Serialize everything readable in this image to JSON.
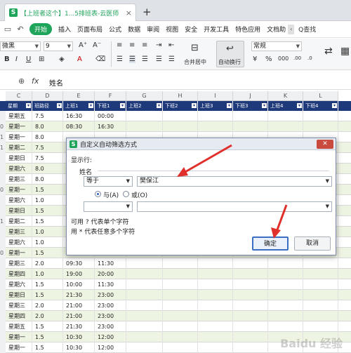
{
  "titlebar": {
    "tab_title": "【上班者这个】1...5排班表-云医师",
    "tab_icon_letter": "S",
    "close_glyph": "×",
    "new_tab_glyph": "+"
  },
  "menubar": {
    "start": "开始",
    "items": [
      "插入",
      "页面布局",
      "公式",
      "数据",
      "审阅",
      "视图",
      "安全",
      "开发工具",
      "特色应用",
      "文档助"
    ],
    "more_glyph": "‹",
    "search": "Q查找"
  },
  "ribbon": {
    "font_name": "微黑",
    "font_size": "9",
    "merge_center": "合并居中",
    "wrap_text": "自动换行",
    "number_format": "常规"
  },
  "formulabar": {
    "fx_label": "fx",
    "content": "姓名"
  },
  "columns": [
    "C",
    "D",
    "E",
    "F",
    "G",
    "H",
    "I",
    "J",
    "K",
    "L"
  ],
  "header_row": [
    "星期",
    "班路径",
    "上班1",
    "下班1",
    "上班2",
    "下班2",
    "上班3",
    "下班3",
    "上班4",
    "下班4"
  ],
  "rows": [
    {
      "rn": "",
      "day": "星期五",
      "hours": "7.5",
      "start": "16:30",
      "end": "00:00",
      "green": false
    },
    {
      "rn": "0",
      "day": "星期一",
      "hours": "8.0",
      "start": "08:30",
      "end": "16:30",
      "green": true
    },
    {
      "rn": "1",
      "day": "星期一",
      "hours": "8.0",
      "start": "",
      "end": "",
      "green": false
    },
    {
      "rn": "1",
      "day": "星期二",
      "hours": "7.5",
      "start": "",
      "end": "",
      "green": true
    },
    {
      "rn": "",
      "day": "星期日",
      "hours": "7.5",
      "start": "",
      "end": "",
      "green": false
    },
    {
      "rn": "",
      "day": "星期六",
      "hours": "8.0",
      "start": "",
      "end": "",
      "green": true
    },
    {
      "rn": "",
      "day": "星期三",
      "hours": "8.0",
      "start": "",
      "end": "",
      "green": false
    },
    {
      "rn": "0",
      "day": "星期一",
      "hours": "1.5",
      "start": "",
      "end": "",
      "green": true
    },
    {
      "rn": "",
      "day": "星期六",
      "hours": "1.0",
      "start": "",
      "end": "",
      "green": false
    },
    {
      "rn": "",
      "day": "星期日",
      "hours": "1.5",
      "start": "",
      "end": "",
      "green": true
    },
    {
      "rn": "1",
      "day": "星期二",
      "hours": "1.5",
      "start": "",
      "end": "",
      "green": false
    },
    {
      "rn": "",
      "day": "星期三",
      "hours": "1.0",
      "start": "",
      "end": "",
      "green": true
    },
    {
      "rn": "",
      "day": "星期六",
      "hours": "1.0",
      "start": "",
      "end": "",
      "green": false
    },
    {
      "rn": "0",
      "day": "星期一",
      "hours": "1.5",
      "start": "20:00",
      "end": "21:30",
      "green": true
    },
    {
      "rn": "",
      "day": "星期三",
      "hours": "2.0",
      "start": "09:30",
      "end": "11:30",
      "green": false
    },
    {
      "rn": "",
      "day": "星期四",
      "hours": "1.0",
      "start": "19:00",
      "end": "20:00",
      "green": true
    },
    {
      "rn": "",
      "day": "星期六",
      "hours": "1.5",
      "start": "10:00",
      "end": "11:30",
      "green": false
    },
    {
      "rn": "",
      "day": "星期日",
      "hours": "1.5",
      "start": "21:30",
      "end": "23:00",
      "green": true
    },
    {
      "rn": "",
      "day": "星期三",
      "hours": "2.0",
      "start": "21:00",
      "end": "23:00",
      "green": false
    },
    {
      "rn": "",
      "day": "星期四",
      "hours": "2.0",
      "start": "21:00",
      "end": "23:00",
      "green": true
    },
    {
      "rn": "",
      "day": "星期五",
      "hours": "1.5",
      "start": "21:30",
      "end": "23:00",
      "green": false
    },
    {
      "rn": "",
      "day": "星期一",
      "hours": "1.5",
      "start": "10:30",
      "end": "12:00",
      "green": true
    },
    {
      "rn": "",
      "day": "星期一",
      "hours": "1.5",
      "start": "10:30",
      "end": "12:00",
      "green": false
    }
  ],
  "dialog": {
    "title": "自定义自动筛选方式",
    "icon_letter": "S",
    "close_glyph": "✕",
    "show_rows_label": "显示行:",
    "field_label": "姓名",
    "op1": "等于",
    "value1": "樊保江",
    "and_label": "与(A)",
    "or_label": "或(O)",
    "op2": "",
    "value2": "",
    "hint1": "可用 ? 代表单个字符",
    "hint2": "用 * 代表任意多个字符",
    "ok": "确定",
    "cancel": "取消"
  },
  "annotation_color": "#e0302b",
  "watermark": "Baidu 经验"
}
